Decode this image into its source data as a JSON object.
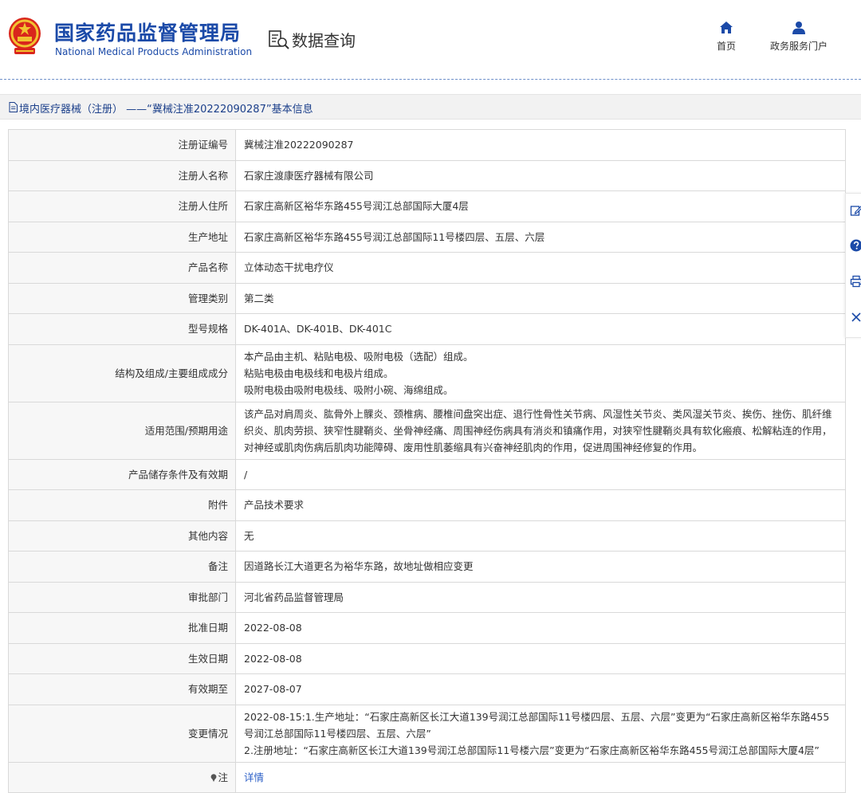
{
  "header": {
    "emblem_icon": "national-emblem-icon",
    "logo_cn": "国家药品监督管理局",
    "logo_en": "National Medical Products Administration",
    "query_icon": "data-query-icon",
    "query_title": "数据查询",
    "nav": [
      {
        "icon": "home-icon",
        "label": "首页"
      },
      {
        "icon": "user-icon",
        "label": "政务服务门户"
      }
    ]
  },
  "title_bar": {
    "icon": "document-icon",
    "text": "境内医疗器械（注册） ——“冀械注准20222090287”基本信息"
  },
  "fields": [
    {
      "label": "注册证编号",
      "value": "冀械注准20222090287"
    },
    {
      "label": "注册人名称",
      "value": "石家庄渡康医疗器械有限公司"
    },
    {
      "label": "注册人住所",
      "value": "石家庄高新区裕华东路455号润江总部国际大厦4层"
    },
    {
      "label": "生产地址",
      "value": "石家庄高新区裕华东路455号润江总部国际11号楼四层、五层、六层"
    },
    {
      "label": "产品名称",
      "value": "立体动态干扰电疗仪"
    },
    {
      "label": "管理类别",
      "value": "第二类"
    },
    {
      "label": "型号规格",
      "value": "DK-401A、DK-401B、DK-401C"
    },
    {
      "label": "结构及组成/主要组成成分",
      "lines": [
        "本产品由主机、粘贴电极、吸附电极（选配）组成。",
        "粘贴电极由电极线和电极片组成。",
        "吸附电极由吸附电极线、吸附小碗、海绵组成。"
      ]
    },
    {
      "label": "适用范围/预期用途",
      "value": "该产品对肩周炎、肱骨外上髁炎、颈椎病、腰椎间盘突出症、退行性骨性关节病、风湿性关节炎、类风湿关节炎、挨伤、挫伤、肌纤维织炎、肌肉劳损、狭窄性腱鞘炎、坐骨神经痛、周围神经伤病具有消炎和镇痛作用，对狭窄性腱鞘炎具有软化瘢痕、松解粘连的作用，对神经或肌肉伤病后肌肉功能障碍、废用性肌萎缩具有兴奋神经肌肉的作用，促进周围神经修复的作用。"
    },
    {
      "label": "产品储存条件及有效期",
      "value": "/"
    },
    {
      "label": "附件",
      "value": "产品技术要求"
    },
    {
      "label": "其他内容",
      "value": "无"
    },
    {
      "label": "备注",
      "value": "因道路长江大道更名为裕华东路，故地址做相应变更"
    },
    {
      "label": "审批部门",
      "value": "河北省药品监督管理局"
    },
    {
      "label": "批准日期",
      "value": "2022-08-08"
    },
    {
      "label": "生效日期",
      "value": "2022-08-08"
    },
    {
      "label": "有效期至",
      "value": "2027-08-07"
    },
    {
      "label": "变更情况",
      "lines": [
        "2022-08-15:1.生产地址：“石家庄高新区长江大道139号润江总部国际11号楼四层、五层、六层”变更为“石家庄高新区裕华东路455号润江总部国际11号楼四层、五层、六层”",
        "2.注册地址：“石家庄高新区长江大道139号润江总部国际11号楼六层”变更为“石家庄高新区裕华东路455号润江总部国际大厦4层”"
      ]
    }
  ],
  "note": {
    "icon": "pin-icon",
    "label": "注",
    "link_text": "详情"
  },
  "side_toolbar": [
    "edit-icon",
    "help-icon",
    "print-icon",
    "close-icon"
  ],
  "colors": {
    "brand": "#1b4aa8",
    "link": "#2b5fc7",
    "label_bg": "#f7f7f7",
    "border": "#d9d9d9"
  }
}
